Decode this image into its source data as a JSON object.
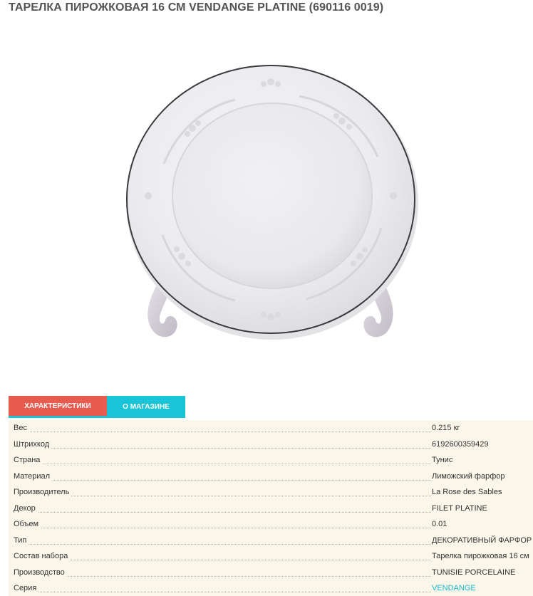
{
  "product": {
    "title": "ТАРЕЛКА ПИРОЖКОВАЯ 16 СМ VENDANGE PLATINE (690116 0019)"
  },
  "tabs": [
    {
      "label": "ХАРАКТЕРИСТИКИ",
      "active": true
    },
    {
      "label": "О МАГАЗИНЕ",
      "active": false
    }
  ],
  "specs": [
    {
      "label": "Вес",
      "value": "0.215 кг"
    },
    {
      "label": "Штрихкод",
      "value": "6192600359429"
    },
    {
      "label": "Страна",
      "value": "Тунис"
    },
    {
      "label": "Материал",
      "value": "Лиможский фарфор"
    },
    {
      "label": "Производитель",
      "value": "La Rose des Sables"
    },
    {
      "label": "Декор",
      "value": "FILET PLATINE"
    },
    {
      "label": "Объем",
      "value": "0.01"
    },
    {
      "label": "Тип",
      "value": "ДЕКОРАТИВНЫЙ ФАРФОР"
    },
    {
      "label": "Состав набора",
      "value": "Тарелка пирожковая 16 см"
    },
    {
      "label": "Производство",
      "value": "TUNISIE PORCELAINE"
    },
    {
      "label": "Серия",
      "value": "VENDANGE"
    }
  ],
  "colors": {
    "tab_active": "#e85c4f",
    "tab_inactive": "#19c4d8",
    "specs_background": "#fbf6ea",
    "link": "#19b9cc"
  }
}
